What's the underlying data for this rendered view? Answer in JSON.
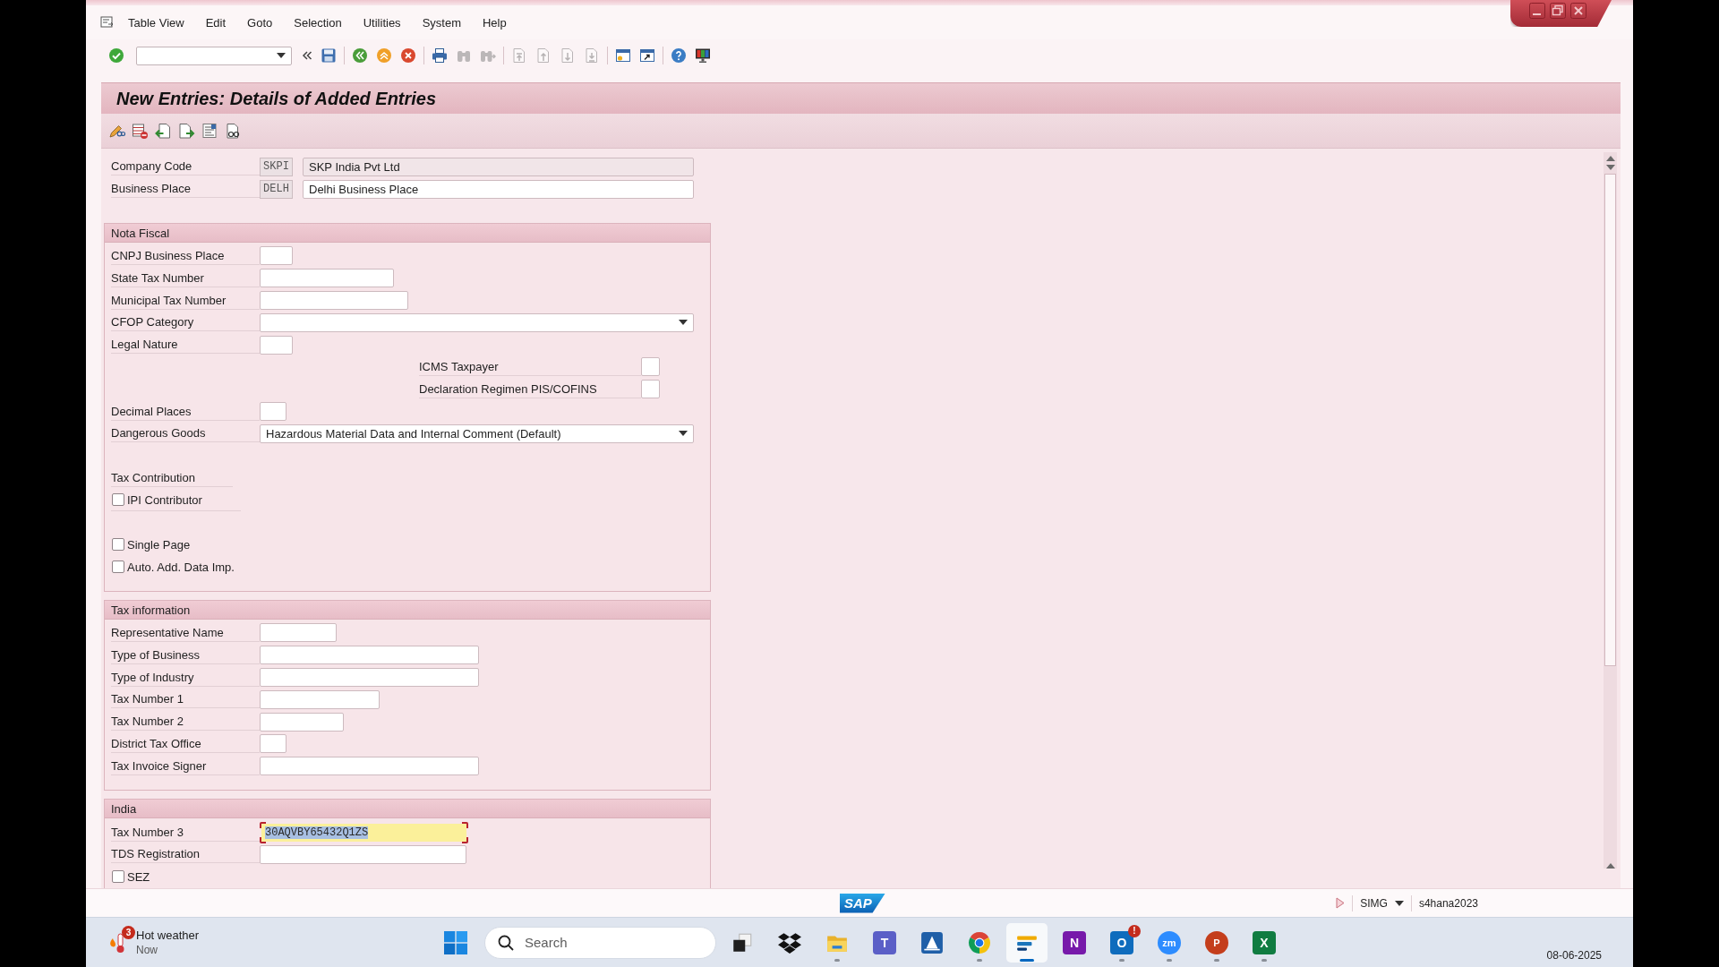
{
  "menu_bar": {
    "items": [
      "Table View",
      "Edit",
      "Goto",
      "Selection",
      "Utilities",
      "System",
      "Help"
    ]
  },
  "toolbar": {
    "groups": [
      [
        {
          "kind": "enter",
          "disabled": false
        },
        {
          "kind": "command-field",
          "disabled": false
        },
        {
          "kind": "collapse",
          "disabled": false
        },
        {
          "kind": "save",
          "disabled": false
        }
      ],
      [
        {
          "kind": "back",
          "disabled": false
        },
        {
          "kind": "exit",
          "disabled": false
        },
        {
          "kind": "cancel",
          "disabled": false
        }
      ],
      [
        {
          "kind": "print",
          "disabled": false
        },
        {
          "kind": "find",
          "disabled": true
        },
        {
          "kind": "find-next",
          "disabled": true
        }
      ],
      [
        {
          "kind": "first-page",
          "disabled": true
        },
        {
          "kind": "previous-page",
          "disabled": true
        },
        {
          "kind": "next-page",
          "disabled": true
        },
        {
          "kind": "last-page",
          "disabled": true
        }
      ],
      [
        {
          "kind": "new-session",
          "disabled": false
        },
        {
          "kind": "shortcut",
          "disabled": false
        }
      ],
      [
        {
          "kind": "help",
          "disabled": false
        },
        {
          "kind": "layout",
          "disabled": false
        }
      ]
    ]
  },
  "title": "New Entries: Details of Added Entries",
  "header_fields": [
    {
      "label": "Company Code",
      "key": "SKPI",
      "value": "SKP India Pvt Ltd",
      "editable": false
    },
    {
      "label": "Business Place",
      "key": "DELH",
      "value": "Delhi Business Place",
      "editable": true
    }
  ],
  "nota_fiscal": {
    "title": "Nota Fiscal",
    "fields": [
      {
        "kind": "input",
        "label": "CNPJ Business Place"
      },
      {
        "kind": "input",
        "label": "State Tax Number"
      },
      {
        "kind": "input",
        "label": "Municipal Tax Number"
      },
      {
        "kind": "dropdown",
        "label": "CFOP Category"
      },
      {
        "kind": "input",
        "label": "Legal Nature"
      },
      {
        "kind": "indented",
        "label": "ICMS Taxpayer"
      },
      {
        "kind": "indented",
        "label": "Declaration Regimen PIS/COFINS"
      },
      {
        "kind": "input",
        "label": "Decimal Places"
      },
      {
        "kind": "dropdown",
        "label": "Dangerous Goods",
        "value": "Hazardous Material Data and Internal Comment (Default)"
      }
    ],
    "tax_contribution": {
      "title": "Tax Contribution",
      "checkboxes": [
        {
          "label": "IPI Contributor",
          "checked": false
        }
      ]
    },
    "checkboxes": [
      {
        "label": "Single Page",
        "checked": false
      },
      {
        "label": "Auto. Add. Data Imp.",
        "checked": false
      }
    ]
  },
  "tax_information": {
    "title": "Tax information",
    "fields": [
      {
        "kind": "input",
        "label": "Representative Name"
      },
      {
        "kind": "input",
        "label": "Type of Business"
      },
      {
        "kind": "input",
        "label": "Type of Industry"
      },
      {
        "kind": "input",
        "label": "Tax Number 1"
      },
      {
        "kind": "input",
        "label": "Tax Number 2"
      },
      {
        "kind": "input",
        "label": "District Tax Office"
      },
      {
        "kind": "input",
        "label": "Tax Invoice Signer"
      }
    ]
  },
  "india": {
    "title": "India",
    "fields": [
      {
        "kind": "input",
        "label": "Tax Number 3",
        "value": "30AQVBY65432Q1ZS",
        "focused": true
      },
      {
        "kind": "input",
        "label": "TDS Registration",
        "focused": false
      }
    ],
    "checkboxes": [
      {
        "label": "SEZ",
        "checked": false
      }
    ]
  },
  "status_bar": {
    "logo": "SAP",
    "transaction": "SIMG",
    "system": "s4hana2023"
  },
  "taskbar": {
    "weather": {
      "badge": "3",
      "title": "Hot weather",
      "subtitle": "Now"
    },
    "search": {
      "placeholder": "Search"
    },
    "apps": [
      {
        "kind": "task-view",
        "running": false,
        "selected": false
      },
      {
        "kind": "dropbox",
        "running": false,
        "selected": false
      },
      {
        "kind": "explorer",
        "running": true,
        "selected": false
      },
      {
        "kind": "teams",
        "glyph": "T",
        "running": false,
        "selected": false
      },
      {
        "kind": "tile",
        "running": false,
        "selected": false
      },
      {
        "kind": "chrome",
        "running": true,
        "selected": false
      },
      {
        "kind": "sap-logon",
        "running": true,
        "selected": true
      },
      {
        "kind": "onenote",
        "glyph": "N",
        "running": false,
        "selected": false
      },
      {
        "kind": "outlook",
        "glyph": "O",
        "badge": "!",
        "running": true,
        "selected": false
      },
      {
        "kind": "zoom",
        "glyph": "zm",
        "running": true,
        "selected": false
      },
      {
        "kind": "powerpoint",
        "glyph": "P",
        "running": true,
        "selected": false
      },
      {
        "kind": "excel",
        "glyph": "X",
        "running": true,
        "selected": false
      }
    ],
    "date": "08-06-2025"
  }
}
